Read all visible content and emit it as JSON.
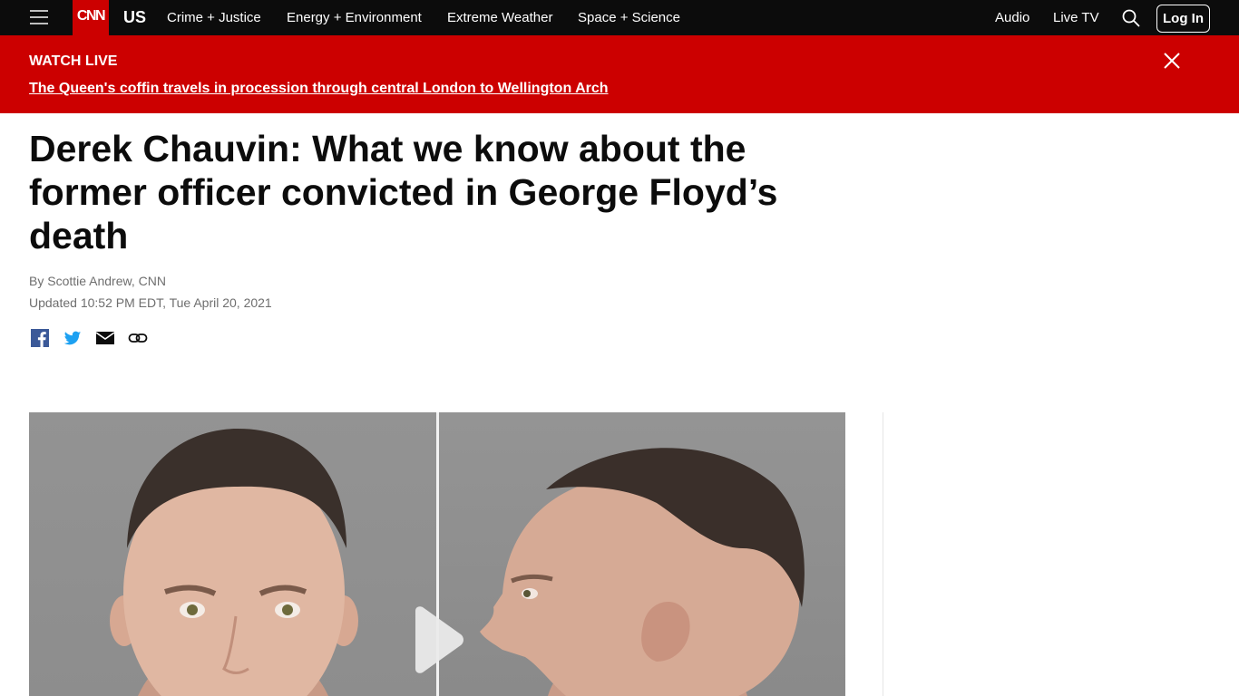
{
  "nav": {
    "logo": "CNN",
    "section": "US",
    "links": [
      "Crime + Justice",
      "Energy + Environment",
      "Extreme Weather",
      "Space + Science"
    ],
    "right_links": [
      "Audio",
      "Live TV"
    ],
    "login_label": "Log In",
    "icons": [
      "menu-icon",
      "search-icon"
    ]
  },
  "live_banner": {
    "label": "WATCH LIVE",
    "headline": "The Queen's coffin travels in procession through central London to Wellington Arch",
    "close_icon": "close-icon"
  },
  "article": {
    "headline": "Derek Chauvin: What we know about the former officer convicted in George Floyd’s death",
    "byline": "By Scottie Andrew, CNN",
    "updated": "Updated 10:52 PM EDT, Tue April 20, 2021",
    "share_icons": [
      "facebook-icon",
      "twitter-icon",
      "email-icon",
      "link-icon"
    ]
  },
  "media": {
    "play_icon": "play-icon"
  },
  "colors": {
    "nav_bg": "#0c0c0c",
    "brand_red": "#cc0000",
    "text": "#0c0c0c",
    "meta_text": "#6e6e6e",
    "facebook": "#3b5998",
    "twitter": "#1da1f2"
  }
}
